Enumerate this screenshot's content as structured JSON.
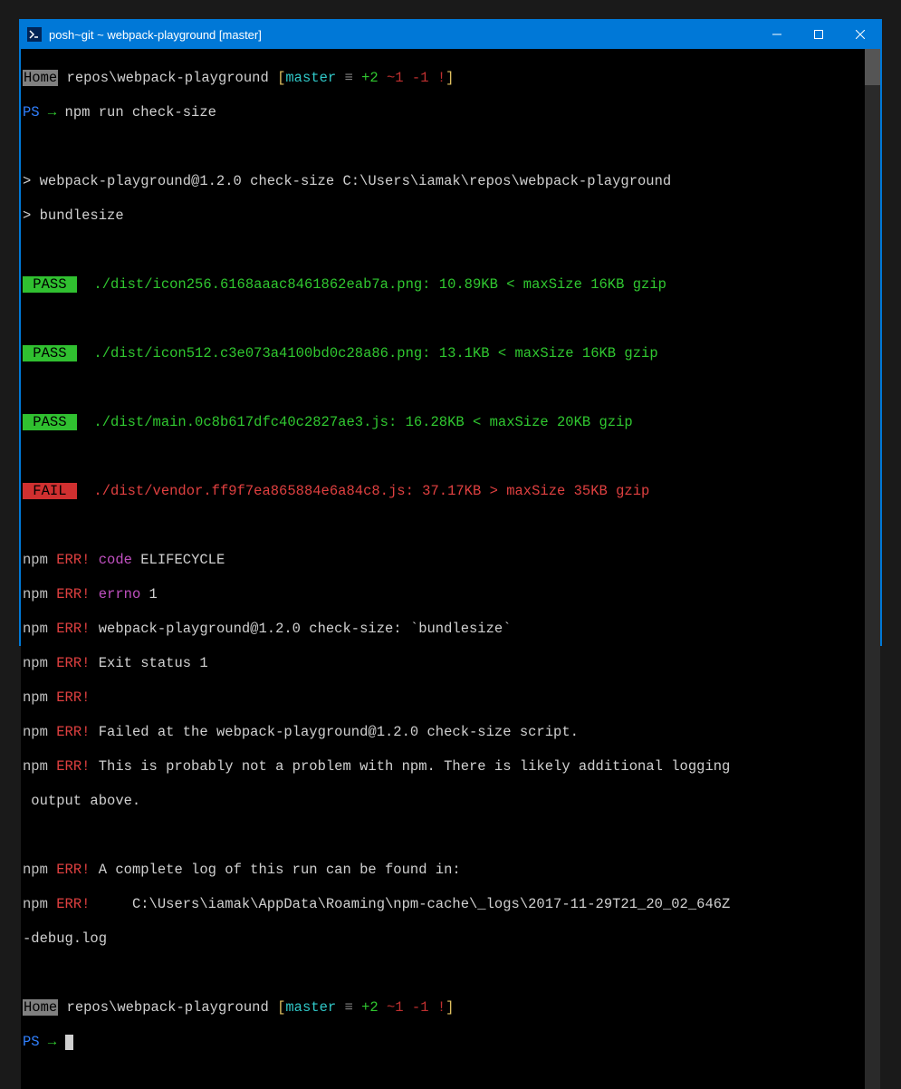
{
  "window": {
    "title": "posh~git ~ webpack-playground [master]"
  },
  "prompt1": {
    "home": "Home",
    "path": " repos\\webpack-playground ",
    "lbr": "[",
    "branch": "master",
    "equiv": " ≡ ",
    "plus": "+2",
    "tilde": " ~1",
    "minus": " -1",
    "excl": " !",
    "rbr": "]"
  },
  "psline1": {
    "ps": "PS ",
    "arrow": "→ ",
    "cmd": "npm run check-size"
  },
  "run": {
    "line1": "> webpack-playground@1.2.0 check-size C:\\Users\\iamak\\repos\\webpack-playground",
    "line2": "> bundlesize"
  },
  "checks": {
    "p1": {
      "badge": " PASS ",
      "text": "  ./dist/icon256.6168aaac8461862eab7a.png: 10.89KB < maxSize 16KB gzip"
    },
    "p2": {
      "badge": " PASS ",
      "text": "  ./dist/icon512.c3e073a4100bd0c28a86.png: 13.1KB < maxSize 16KB gzip"
    },
    "p3": {
      "badge": " PASS ",
      "text": "  ./dist/main.0c8b617dfc40c2827ae3.js: 16.28KB < maxSize 20KB gzip"
    },
    "f1": {
      "badge": " FAIL ",
      "text": "  ./dist/vendor.ff9f7ea865884e6a84c8.js: 37.17KB > maxSize 35KB gzip"
    }
  },
  "errors": {
    "npm": "npm ",
    "err": "ERR!",
    "code_label": " code",
    "code_val": " ELIFECYCLE",
    "errno_label": " errno",
    "errno_val": " 1",
    "l3": " webpack-playground@1.2.0 check-size: `bundlesize`",
    "l4": " Exit status 1",
    "l6": " Failed at the webpack-playground@1.2.0 check-size script.",
    "l7": " This is probably not a problem with npm. There is likely additional logging",
    "l7b": " output above.",
    "l9": " A complete log of this run can be found in:",
    "l10": "     C:\\Users\\iamak\\AppData\\Roaming\\npm-cache\\_logs\\2017-11-29T21_20_02_646Z",
    "l10b": "-debug.log"
  },
  "prompt2": {
    "home": "Home",
    "path": " repos\\webpack-playground ",
    "lbr": "[",
    "branch": "master",
    "equiv": " ≡ ",
    "plus": "+2",
    "tilde": " ~1",
    "minus": " -1",
    "excl": " !",
    "rbr": "]"
  },
  "psline2": {
    "ps": "PS ",
    "arrow": "→ "
  }
}
